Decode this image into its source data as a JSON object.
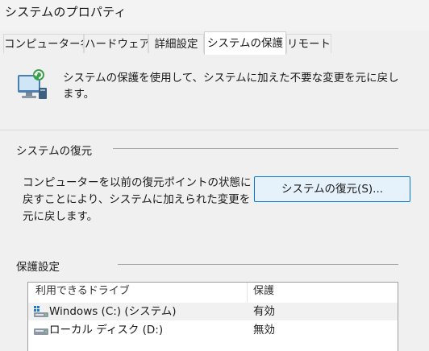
{
  "window": {
    "title": "システムのプロパティ"
  },
  "tabs": [
    {
      "label": "コンピューター名"
    },
    {
      "label": "ハードウェア"
    },
    {
      "label": "詳細設定"
    },
    {
      "label": "システムの保護"
    },
    {
      "label": "リモート"
    }
  ],
  "intro": {
    "icon": "system-protection-icon",
    "text": "システムの保護を使用して、システムに加えた不要な変更を元に戻します。"
  },
  "restore": {
    "section_label": "システムの復元",
    "description": "コンピューターを以前の復元ポイントの状態に戻すことにより、システムに加えられた変更を元に戻します。",
    "button_label": "システムの復元(S)..."
  },
  "protection_settings": {
    "section_label": "保護設定",
    "columns": {
      "drive": "利用できるドライブ",
      "protection": "保護"
    },
    "drives": [
      {
        "name": "Windows (C:) (システム)",
        "protection": "有効",
        "icon": "system-drive-icon"
      },
      {
        "name": "ローカル ディスク (D:)",
        "protection": "無効",
        "icon": "local-disk-icon"
      }
    ]
  },
  "colors": {
    "accent": "#0078d4",
    "button_bg": "#e5f1fb",
    "panel_bg": "#f0f0f0"
  }
}
